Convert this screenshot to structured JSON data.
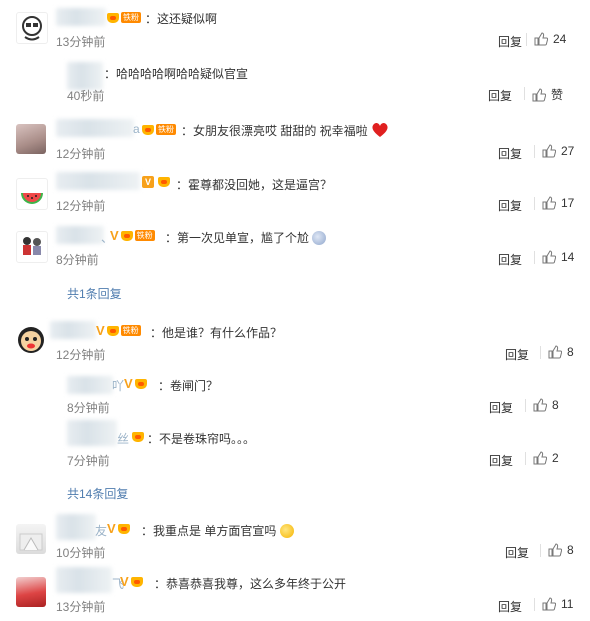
{
  "comments": [
    {
      "id": "c1",
      "name_suffix": "",
      "text": "：这还疑似啊",
      "time": "13分钟前",
      "reply": "回复",
      "likes": "24"
    },
    {
      "id": "r1",
      "name_suffix": "",
      "text": "：哈哈哈哈啊哈哈疑似官宣",
      "time": "40秒前",
      "reply": "回复",
      "likes": "赞"
    },
    {
      "id": "c2",
      "name_suffix": "a",
      "text": "：女朋友很漂亮哎 甜甜的 祝幸福啦",
      "time": "12分钟前",
      "reply": "回复",
      "likes": "27"
    },
    {
      "id": "c3",
      "name_suffix": "",
      "text": "：霍尊都没回她，这是逼宫？",
      "time": "12分钟前",
      "reply": "回复",
      "likes": "17"
    },
    {
      "id": "c4",
      "name_suffix": "、",
      "text": "：第一次见单宣，尴了个尬",
      "time": "8分钟前",
      "reply": "回复",
      "likes": "14"
    },
    {
      "id": "c5",
      "name_suffix": "",
      "text": "：他是谁？有什么作品？",
      "time": "12分钟前",
      "reply": "回复",
      "likes": "8"
    },
    {
      "id": "r2",
      "name_suffix": "吖",
      "text": "：卷闸门？",
      "time": "8分钟前",
      "reply": "回复",
      "likes": "8"
    },
    {
      "id": "r3",
      "name_suffix": "丝",
      "text": "：不是卷珠帘吗。。。",
      "time": "7分钟前",
      "reply": "回复",
      "likes": "2"
    },
    {
      "id": "c6",
      "name_suffix": "友",
      "text": "：我重点是 单方面官宣吗",
      "time": "10分钟前",
      "reply": "回复",
      "likes": "8"
    },
    {
      "id": "c7",
      "name_suffix": "飞",
      "text": "：恭喜恭喜我尊，这么多年终于公开",
      "time": "13分钟前",
      "reply": "回复",
      "likes": "11"
    }
  ],
  "more_links": {
    "c4_more": "共1条回复",
    "c5_more": "共14条回复"
  },
  "badges": {
    "fan": "铁粉",
    "v": "V"
  },
  "colors": {
    "link": "#507daf",
    "time": "#808080",
    "v_badge": "#f7a11b"
  },
  "icons": {
    "like": "thumbs-up-icon",
    "heart": "red-heart-emoji",
    "emoji_shock": "shocked-face-emoji",
    "emoji_laugh": "laughing-tears-emoji"
  }
}
